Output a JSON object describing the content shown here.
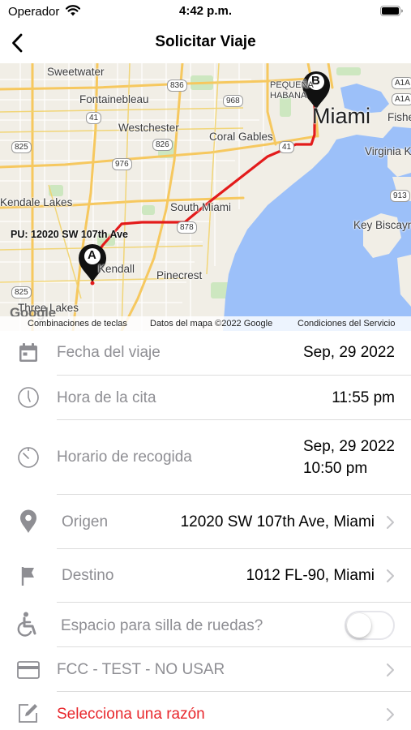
{
  "status_bar": {
    "carrier": "Operador",
    "time": "4:42 p.m."
  },
  "nav": {
    "title": "Solicitar Viaje"
  },
  "map": {
    "places": [
      "Sweetwater",
      "Fontainebleau",
      "Westchester",
      "Coral Gables",
      "Kendale Lakes",
      "South Miami",
      "Pinecrest",
      "Three Lakes",
      "Miami",
      "Fisher",
      "Virginia K",
      "Key Biscayne",
      "PEQUEÑA",
      "HABANA",
      "Kendall"
    ],
    "road_shields": [
      "836",
      "41",
      "968",
      "A1A",
      "A1A",
      "826",
      "825",
      "976",
      "913",
      "878",
      "825",
      "41"
    ],
    "pickup_label": "PU: 12020 SW 107th Ave",
    "marker_a": "A",
    "marker_b": "B",
    "google_logo": "Google",
    "footer": {
      "shortcuts": "Combinaciones de teclas",
      "data": "Datos del mapa ©2022 Google",
      "terms": "Condiciones del Servicio"
    },
    "colors": {
      "route": "#e31b1b",
      "water": "#9cc0f9",
      "park": "#cde7c0",
      "major_road": "#f6c85f"
    }
  },
  "form": {
    "trip_date": {
      "label": "Fecha del viaje",
      "value": "Sep, 29 2022"
    },
    "appointment_time": {
      "label": "Hora de la cita",
      "value": "11:55 pm"
    },
    "pickup_window": {
      "label": "Horario de recogida",
      "value_line1": "Sep, 29 2022",
      "value_line2": "10:50 pm"
    },
    "origin": {
      "label": "Origen",
      "value": "12020 SW 107th Ave, Miami"
    },
    "destination": {
      "label": "Destino",
      "value": "1012 FL-90, Miami"
    },
    "wheelchair": {
      "label": "Espacio para silla de ruedas?",
      "enabled": false
    },
    "payment": {
      "label": "FCC - TEST - NO USAR"
    },
    "reason": {
      "label": "Selecciona una razón",
      "color": "#e8282d"
    }
  },
  "icons": [
    "calendar-icon",
    "clock-icon",
    "timer-icon",
    "location-pin-icon",
    "flag-icon",
    "wheelchair-icon",
    "credit-card-icon",
    "edit-icon",
    "chevron-right-icon",
    "back-chevron-icon",
    "wifi-icon",
    "battery-icon"
  ]
}
